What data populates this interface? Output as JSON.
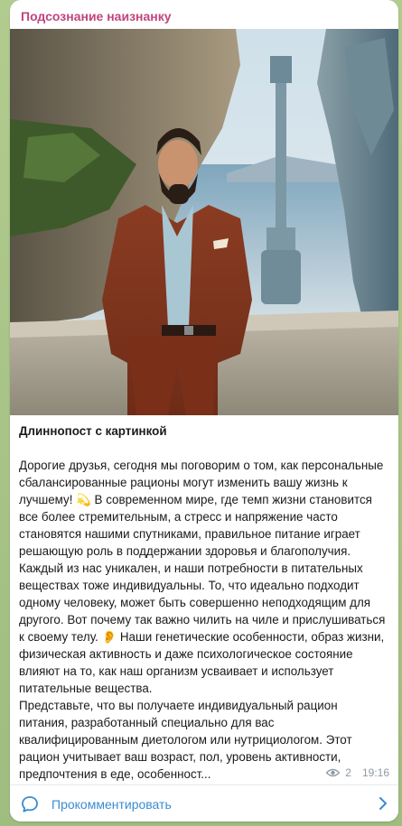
{
  "channel": {
    "name": "Подсознание наизнанку",
    "name_color": "#c0457d"
  },
  "post": {
    "image": "man-in-brown-suit-by-sea-photo",
    "title": "Длиннопост с картинкой",
    "paragraphs": [
      "Дорогие друзья, сегодня мы поговорим о том, как персональные сбалансированные рационы могут изменить вашу жизнь к лучшему! 💫 В современном мире, где темп жизни становится все более стремительным, а стресс и напряжение часто становятся нашими спутниками, правильное питание играет решающую роль в поддержании здоровья и благополучия.",
      "Каждый из нас уникален, и наши потребности в питательных веществах тоже индивидуальны. То, что идеально подходит одному человеку, может быть совершенно неподходящим для другого. Вот почему так важно чилить на чиле и прислушиваться к своему телу. 👂 Наши генетические особенности, образ жизни, физическая активность и даже психологическое состояние влияют на то, как наш организм усваивает и использует питательные вещества.",
      "Представьте, что вы получаете индивидуальный рацион питания, разработанный специально для вас квалифицированным диетологом или нутрициологом. Этот рацион учитывает ваш возраст, пол, уровень активности, предпочтения в еде, особенност..."
    ]
  },
  "meta": {
    "views": "2",
    "time": "19:16",
    "views_icon": "eye-icon"
  },
  "comment_bar": {
    "label": "Прокомментировать",
    "label_color": "#3a8cd1",
    "icon": "comment-bubble-icon",
    "arrow_icon": "chevron-right-icon"
  }
}
